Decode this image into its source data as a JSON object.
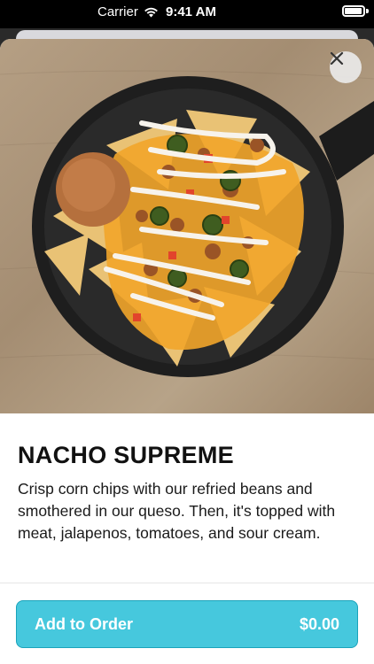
{
  "status_bar": {
    "carrier": "Carrier",
    "time": "9:41 AM"
  },
  "product": {
    "title": "NACHO SUPREME",
    "description": "Crisp corn chips with our refried beans and smothered in our queso. Then, it's topped with meat, jalapenos, tomatoes, and sour cream.",
    "image_icon": "nacho-photo"
  },
  "actions": {
    "add_label": "Add to Order",
    "price": "$0.00",
    "close_icon": "close-icon"
  },
  "colors": {
    "accent": "#46c8dd",
    "accent_border": "#1aa3bb"
  }
}
